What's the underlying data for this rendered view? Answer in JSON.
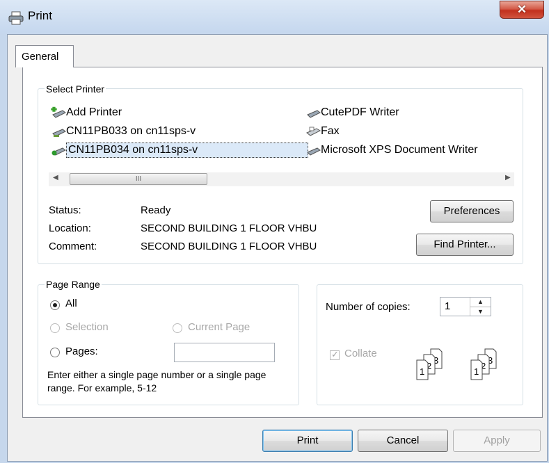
{
  "window": {
    "title": "Print",
    "close_icon": "close-icon"
  },
  "tabs": [
    {
      "label": "General"
    }
  ],
  "select_printer": {
    "label": "Select Printer",
    "printers": [
      {
        "name": "Add Printer",
        "icon": "add-printer-icon"
      },
      {
        "name": "CN11PB033 on cn11sps-v",
        "icon": "network-printer-icon"
      },
      {
        "name": "CN11PB034 on cn11sps-v",
        "icon": "default-network-printer-icon",
        "selected": true
      },
      {
        "name": "CutePDF Writer",
        "icon": "printer-icon"
      },
      {
        "name": "Fax",
        "icon": "fax-icon"
      },
      {
        "name": "Microsoft XPS Document Writer",
        "icon": "printer-icon"
      }
    ],
    "scroll_thumb_glyph": "III",
    "status_label": "Status:",
    "status_value": "Ready",
    "location_label": "Location:",
    "location_value": "SECOND BUILDING 1 FLOOR VHBU",
    "comment_label": "Comment:",
    "comment_value": "SECOND BUILDING 1 FLOOR VHBU",
    "preferences_button": "Preferences",
    "find_printer_button": "Find Printer..."
  },
  "page_range": {
    "label": "Page Range",
    "all": "All",
    "selection": "Selection",
    "current_page": "Current Page",
    "pages": "Pages:",
    "pages_value": "",
    "hint": "Enter either a single page number or a single page range.  For example, 5-12",
    "selected_option": "All"
  },
  "copies": {
    "label": "Number of copies:",
    "value": "1",
    "collate_label": "Collate",
    "collate_checked": true
  },
  "buttons": {
    "print": "Print",
    "cancel": "Cancel",
    "apply": "Apply"
  }
}
